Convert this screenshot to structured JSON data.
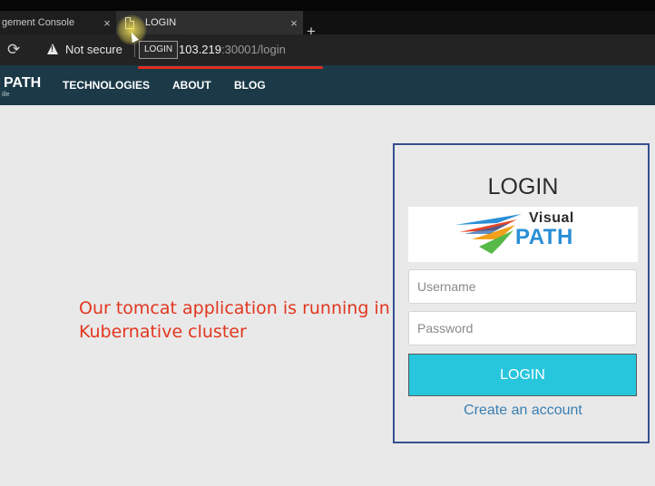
{
  "browser": {
    "tabs": [
      {
        "title": "gement Console",
        "close": "×",
        "active": false
      },
      {
        "title": "LOGIN",
        "close": "×",
        "active": true
      }
    ],
    "new_tab": "+",
    "reload_glyph": "⟳",
    "security_label": "Not secure",
    "tooltip": "LOGIN",
    "url_host": "103.219",
    "url_rest": ":30001/login",
    "accent_underline_color": "#e22d1f"
  },
  "site_nav": {
    "brand": "PATH",
    "brand_sub": "ille",
    "links": [
      "TECHNOLOGIES",
      "ABOUT",
      "BLOG"
    ],
    "background": "#1b3947"
  },
  "annotation": {
    "line1": "Our tomcat application is running in the",
    "line2": "Kubernative cluster",
    "color": "#e2361f"
  },
  "login": {
    "title": "LOGIN",
    "logo_line1": "Visual",
    "logo_line2": "PATH",
    "username_placeholder": "Username",
    "password_placeholder": "Password",
    "submit_label": "LOGIN",
    "create_account": "Create an account",
    "button_color": "#28c6dd",
    "border_color": "#35508f"
  }
}
